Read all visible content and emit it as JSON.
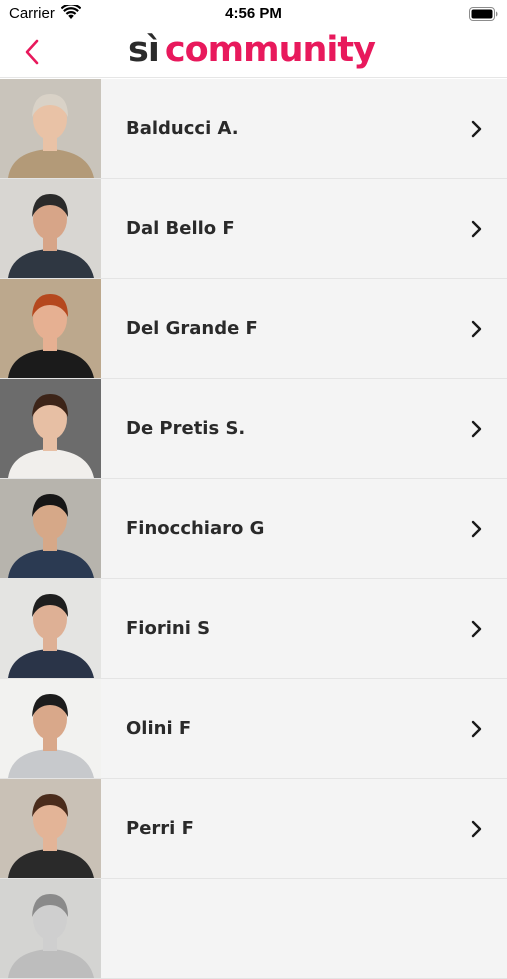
{
  "status_bar": {
    "carrier": "Carrier",
    "time": "4:56 PM"
  },
  "header": {
    "back_icon": "chevron-left-icon",
    "logo_si": "sì",
    "logo_community": "community",
    "accent_color": "#e8195c",
    "logo_dark_color": "#2b2b2b"
  },
  "people": [
    {
      "name": "Balducci A.",
      "avatar": {
        "bg": "#c9c4bb",
        "skin": "#e9c2a6",
        "hair": "#d9d2c7",
        "shirt": "#b39a78"
      }
    },
    {
      "name": "Dal Bello F",
      "avatar": {
        "bg": "#d8d6d2",
        "skin": "#d7a588",
        "hair": "#2a2a2a",
        "shirt": "#2f3742"
      }
    },
    {
      "name": "Del Grande F",
      "avatar": {
        "bg": "#bca88d",
        "skin": "#e6b092",
        "hair": "#b5481e",
        "shirt": "#1b1b1b"
      }
    },
    {
      "name": "De Pretis S.",
      "avatar": {
        "bg": "#6c6c6c",
        "skin": "#e7bfa4",
        "hair": "#3c2418",
        "shirt": "#f1efec"
      }
    },
    {
      "name": "Finocchiaro G",
      "avatar": {
        "bg": "#b7b4ad",
        "skin": "#d6a888",
        "hair": "#161616",
        "shirt": "#2b3a52"
      }
    },
    {
      "name": "Fiorini S",
      "avatar": {
        "bg": "#e4e4e2",
        "skin": "#deb095",
        "hair": "#1e1e1e",
        "shirt": "#2a3448"
      }
    },
    {
      "name": "Olini F",
      "avatar": {
        "bg": "#f2f2f0",
        "skin": "#d9a88a",
        "hair": "#1c1c1c",
        "shirt": "#c7c9cc"
      }
    },
    {
      "name": "Perri F",
      "avatar": {
        "bg": "#c9c1b6",
        "skin": "#e3b497",
        "hair": "#4a2c1c",
        "shirt": "#2a2a2a"
      }
    },
    {
      "name": "",
      "avatar": {
        "bg": "#d4d4d2",
        "skin": "#cfcfcf",
        "hair": "#8a8a8a",
        "shirt": "#bdbdbd"
      }
    }
  ]
}
